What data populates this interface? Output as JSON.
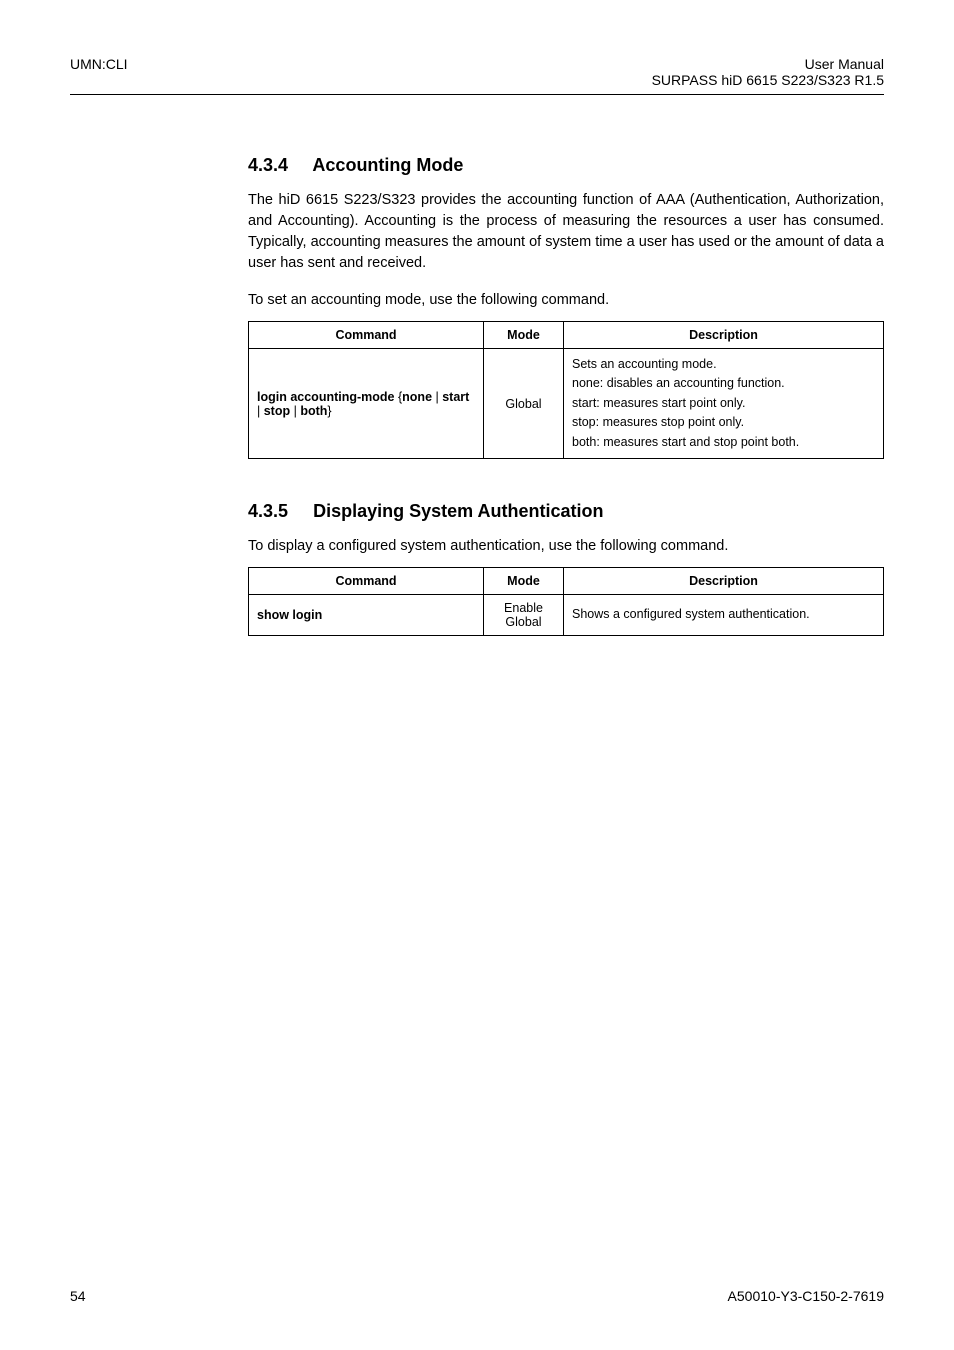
{
  "header": {
    "left": "UMN:CLI",
    "right_line1": "User Manual",
    "right_line2": "SURPASS hiD 6615 S223/S323 R1.5"
  },
  "sections": {
    "s1": {
      "number": "4.3.4",
      "title": "Accounting Mode",
      "para1": "The hiD 6615 S223/S323 provides the accounting function of AAA (Authentication, Authorization, and Accounting). Accounting is the process of measuring the resources a user has consumed. Typically, accounting measures the amount of system time a user has used or the amount of data a user has sent and received.",
      "para2": "To set an accounting mode, use the following command.",
      "table": {
        "h1": "Command",
        "h2": "Mode",
        "h3": "Description",
        "cmd_bold_pre": "login accounting-mode ",
        "cmd_brace_open": "{",
        "cmd_opt1": "none",
        "cmd_pipe": " | ",
        "cmd_opt2": "start",
        "cmd_opt3": "stop",
        "cmd_opt4": "both",
        "cmd_brace_close": "}",
        "mode": "Global",
        "d1": "Sets an accounting mode.",
        "d2": "none: disables an accounting function.",
        "d3": "start: measures start point only.",
        "d4": "stop: measures stop point only.",
        "d5": "both: measures start and stop point both."
      }
    },
    "s2": {
      "number": "4.3.5",
      "title": "Displaying System Authentication",
      "para1": "To display a configured system authentication, use the following command.",
      "table": {
        "h1": "Command",
        "h2": "Mode",
        "h3": "Description",
        "cmd": "show login",
        "mode1": "Enable",
        "mode2": "Global",
        "desc": "Shows a configured system authentication."
      }
    }
  },
  "footer": {
    "page": "54",
    "doc": "A50010-Y3-C150-2-7619"
  }
}
